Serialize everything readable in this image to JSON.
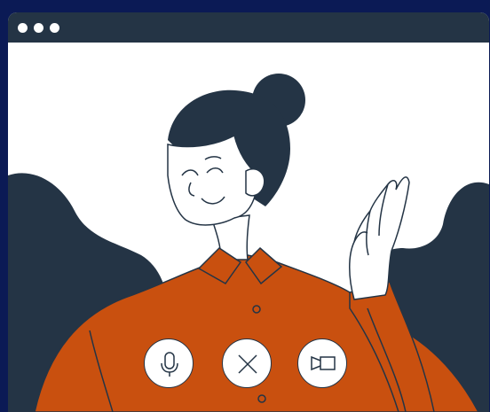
{
  "window": {
    "title_bar_dots": [
      "dot",
      "dot",
      "dot"
    ]
  },
  "controls": {
    "mic_icon": "microphone-icon",
    "hangup_icon": "close-icon",
    "camera_icon": "video-camera-icon"
  },
  "colors": {
    "page_background": "#0b1a55",
    "title_bar": "#243445",
    "shirt": "#c9500f",
    "outline": "#243445",
    "hair": "#243445",
    "skin": "#ffffff"
  }
}
